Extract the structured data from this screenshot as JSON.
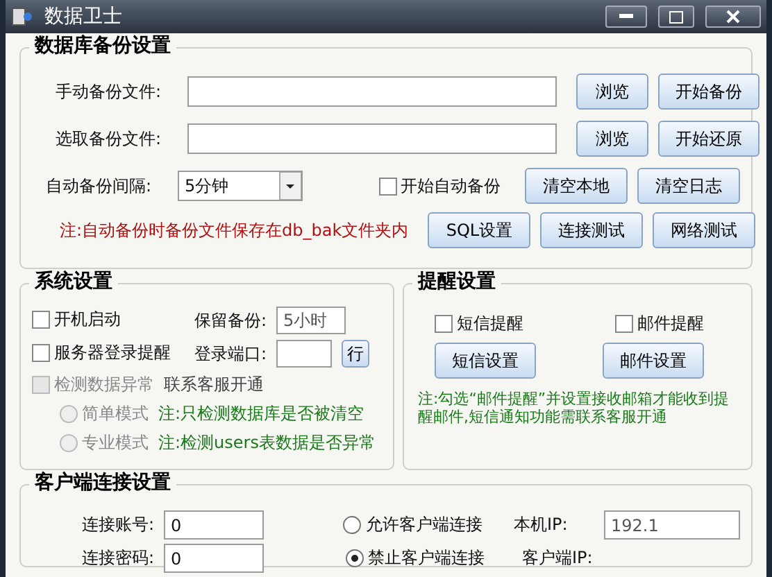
{
  "window": {
    "title": "数据卫士"
  },
  "backup": {
    "title": "数据库备份设置",
    "file_rows": [
      {
        "label": "手动备份文件:",
        "buttons": [
          "浏览",
          "开始备份"
        ]
      },
      {
        "label": "选取备份文件:",
        "buttons": [
          "浏览",
          "开始还原"
        ]
      }
    ],
    "interval": {
      "label": "自动备份间隔:",
      "value": "5分钟"
    },
    "auto_backup": {
      "label": "开始自动备份",
      "checked": false
    },
    "row3_buttons": [
      "清空本地",
      "清空日志"
    ],
    "note": "注:自动备份时备份文件保存在db_bak文件夹内",
    "row4_buttons": [
      "SQL设置",
      "连接测试",
      "网络测试"
    ]
  },
  "system": {
    "title": "系统设置",
    "options": [
      {
        "label": "开机启动",
        "checked": false
      },
      {
        "label": "服务器登录提醒",
        "checked": false
      }
    ],
    "keep": {
      "label": "保留备份:",
      "value": "5小时"
    },
    "port": {
      "label": "登录端口:",
      "button": "行"
    },
    "detect": {
      "label": "检测数据异常",
      "checked": false,
      "disabled": true,
      "hint": "联系客服开通"
    },
    "modes": [
      {
        "label": "简单模式",
        "selected": false,
        "note": "注:只检测数据库是否被清空"
      },
      {
        "label": "专业模式",
        "selected": false,
        "note": "注:检测users表数据是否异常"
      }
    ]
  },
  "reminders": {
    "title": "提醒设置",
    "options": [
      {
        "label": "短信提醒",
        "checked": false
      },
      {
        "label": "邮件提醒",
        "checked": false
      }
    ],
    "buttons": [
      "短信设置",
      "邮件设置"
    ],
    "note": "注:勾选“邮件提醒”并设置接收邮箱才能收到提醒邮件,短信通知功能需联系客服开通"
  },
  "client": {
    "title": "客户端连接设置",
    "rows": [
      {
        "field": {
          "label": "连接账号:",
          "value": "0"
        },
        "radio": {
          "label": "允许客户端连接",
          "selected": false
        },
        "ip": {
          "label": "本机IP:",
          "value": "192.1"
        }
      },
      {
        "field": {
          "label": "连接密码:",
          "value": "0"
        },
        "radio": {
          "label": "禁止客户端连接",
          "selected": true
        },
        "ip": {
          "label": "客户端IP:"
        }
      }
    ]
  }
}
